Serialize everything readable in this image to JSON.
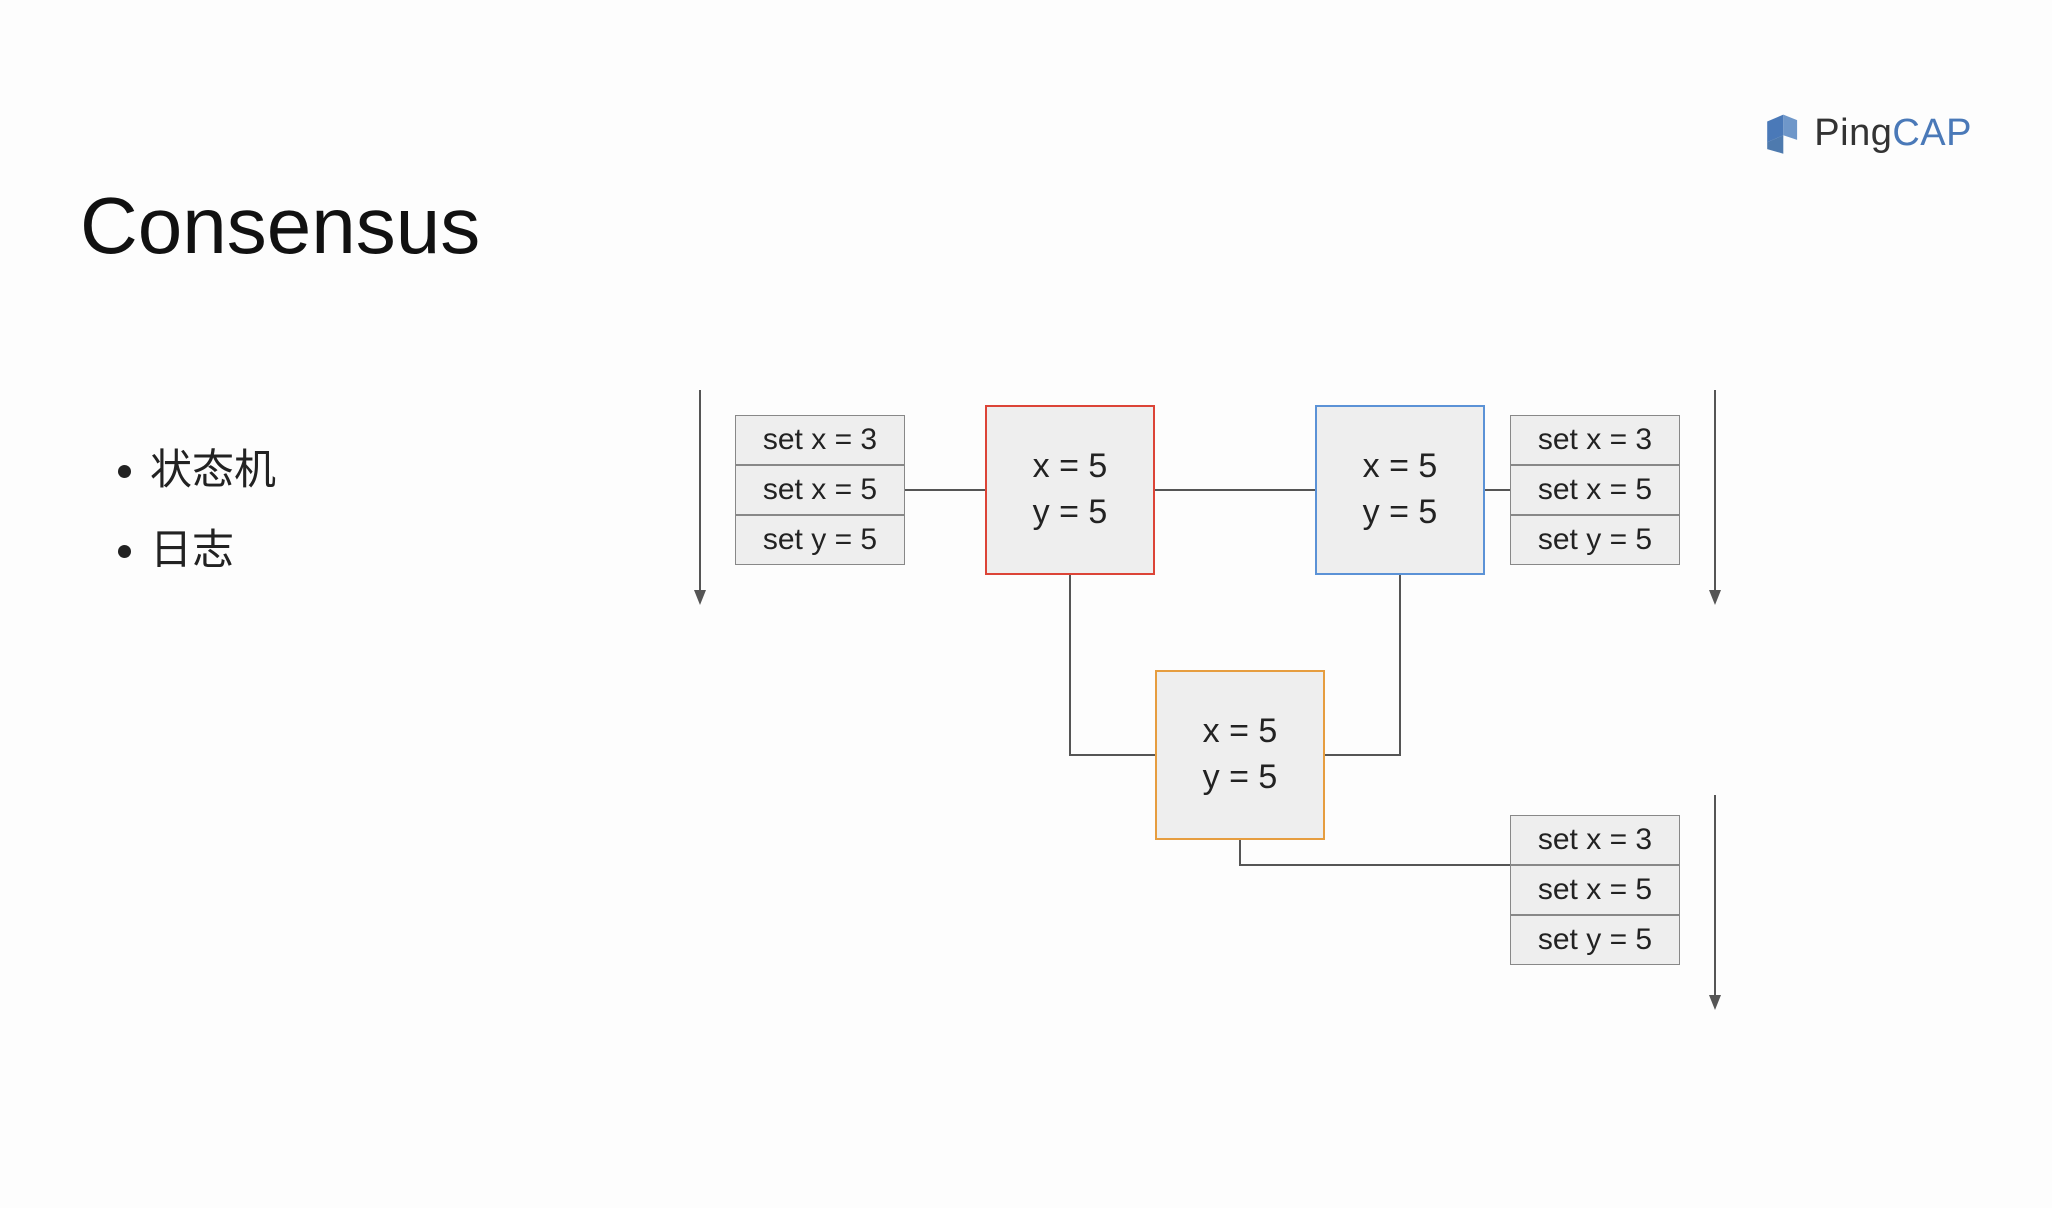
{
  "logo": {
    "ping": "Ping",
    "cap": "CAP"
  },
  "title": "Consensus",
  "bullets": [
    "状态机",
    "日志"
  ],
  "node1": {
    "l1": "x = 5",
    "l2": "y = 5"
  },
  "node2": {
    "l1": "x = 5",
    "l2": "y = 5"
  },
  "node3": {
    "l1": "x = 5",
    "l2": "y = 5"
  },
  "logA": {
    "r1": "set x = 3",
    "r2": "set x = 5",
    "r3": "set y = 5"
  },
  "logB": {
    "r1": "set x = 3",
    "r2": "set x = 5",
    "r3": "set y = 5"
  },
  "logC": {
    "r1": "set x = 3",
    "r2": "set x = 5",
    "r3": "set y = 5"
  }
}
